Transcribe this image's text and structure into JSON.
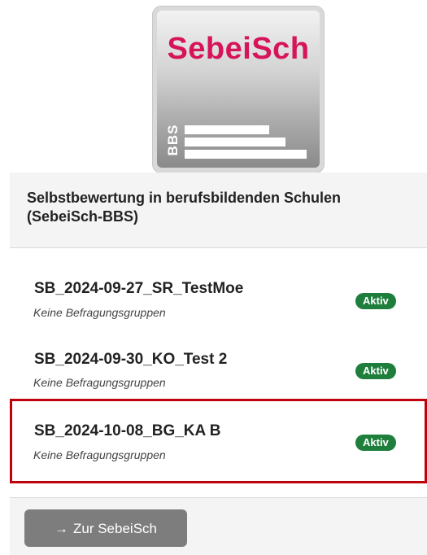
{
  "logo": {
    "text": "SebeiSch",
    "sub_text": "BBS",
    "brand_color": "#d6145a"
  },
  "header": {
    "title": "Selbstbewertung in berufsbildenden Schulen (SebeiSch-BBS)"
  },
  "surveys": [
    {
      "title": "SB_2024-09-27_SR_TestMoe",
      "subtitle": "Keine Befragungsgruppen",
      "status": "Aktiv",
      "selected": false
    },
    {
      "title": "SB_2024-09-30_KO_Test 2",
      "subtitle": "Keine Befragungsgruppen",
      "status": "Aktiv",
      "selected": false
    },
    {
      "title": "SB_2024-10-08_BG_KA B",
      "subtitle": "Keine Befragungsgruppen",
      "status": "Aktiv",
      "selected": true
    }
  ],
  "footer": {
    "button_icon": "→",
    "button_label": "Zur SebeiSch"
  },
  "colors": {
    "status_active": "#1e7e3c",
    "selection_outline": "#c0000a",
    "button_bg": "#7d7d7d"
  }
}
